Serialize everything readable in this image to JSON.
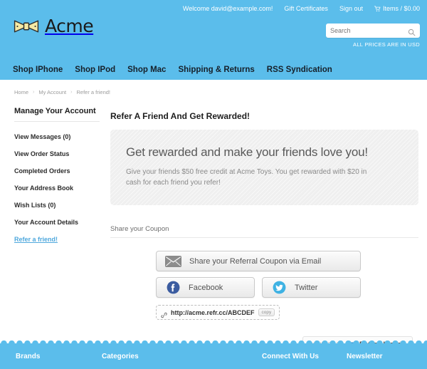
{
  "theme": {
    "brand_blue": "#5bbdeb",
    "link_blue": "#4fa8dd",
    "panel_gray": "#efefef"
  },
  "header": {
    "utility": {
      "welcome": "Welcome david@example.com!",
      "gift_certificates": "Gift Certificates",
      "sign_out": "Sign out",
      "cart_icon": "shopping-cart-icon",
      "cart_text": "Items / $0.00"
    },
    "brand": {
      "name": "Acme",
      "logo_icon": "bow-ribbon-icon"
    },
    "search": {
      "placeholder": "Search",
      "value": "",
      "icon": "search-icon",
      "prices_note": "ALL PRICES ARE IN USD"
    },
    "nav": [
      {
        "label": "Shop IPhone"
      },
      {
        "label": "Shop IPod"
      },
      {
        "label": "Shop Mac"
      },
      {
        "label": "Shipping & Returns"
      },
      {
        "label": "RSS Syndication"
      }
    ]
  },
  "breadcrumb": {
    "items": [
      {
        "label": "Home"
      },
      {
        "label": "My Account"
      },
      {
        "label": "Refer a friend!"
      }
    ],
    "separator": "›"
  },
  "sidebar": {
    "title": "Manage Your Account",
    "items": [
      {
        "label": "View Messages (0)",
        "active": false
      },
      {
        "label": "View Order Status",
        "active": false
      },
      {
        "label": "Completed Orders",
        "active": false
      },
      {
        "label": "Your Address Book",
        "active": false
      },
      {
        "label": "Wish Lists (0)",
        "active": false
      },
      {
        "label": "Your Account Details",
        "active": false
      },
      {
        "label": "Refer a friend!",
        "active": true
      }
    ]
  },
  "main": {
    "page_title": "Refer A Friend And Get Rewarded!",
    "promo": {
      "heading": "Get rewarded and make your friends love you!",
      "body": "Give your friends $50 free credit at Acme Toys. You get rewarded with $20 in cash for each friend you refer!"
    },
    "share": {
      "section_label": "Share your Coupon",
      "email_button": {
        "label": "Share your Referral Coupon via Email",
        "icon": "envelope-icon"
      },
      "facebook_button": {
        "label": "Facebook",
        "icon": "facebook-icon"
      },
      "twitter_button": {
        "label": "Twitter",
        "icon": "twitter-icon"
      },
      "referral_link": {
        "icon": "chain-link-icon",
        "url": "http://acme.refr.cc/ABCDEF",
        "copy_label": "copy"
      }
    },
    "powered_by": {
      "label": "POWERED BY",
      "icon": "referralcandy-icon",
      "name": "ReferralCandy"
    }
  },
  "footer": {
    "columns": [
      {
        "label": "Brands"
      },
      {
        "label": "Categories"
      },
      {
        "label": "Connect With Us"
      },
      {
        "label": "Newsletter"
      }
    ]
  }
}
